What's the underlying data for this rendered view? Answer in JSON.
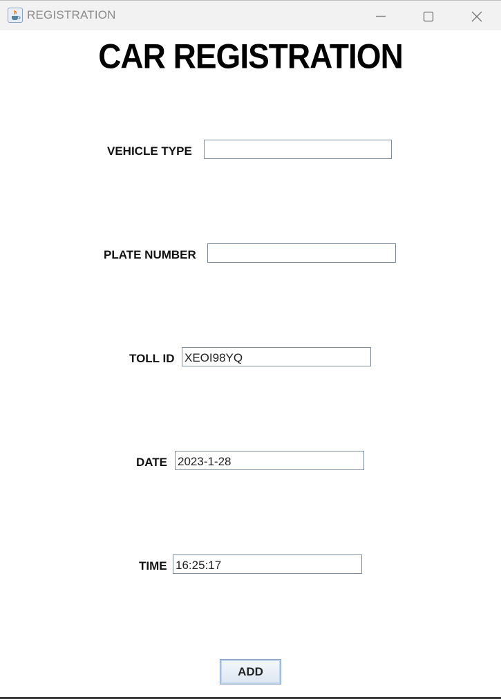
{
  "window": {
    "title": "REGISTRATION",
    "icon": "java-cup-icon"
  },
  "form": {
    "heading": "CAR REGISTRATION",
    "fields": {
      "vehicle_type": {
        "label": "VEHICLE TYPE",
        "value": ""
      },
      "plate_number": {
        "label": "PLATE NUMBER",
        "value": ""
      },
      "toll_id": {
        "label": "TOLL ID",
        "value": "XEOI98YQ"
      },
      "date": {
        "label": "DATE",
        "value": "2023-1-28"
      },
      "time": {
        "label": "TIME",
        "value": "16:25:17"
      }
    },
    "add_label": "ADD"
  }
}
